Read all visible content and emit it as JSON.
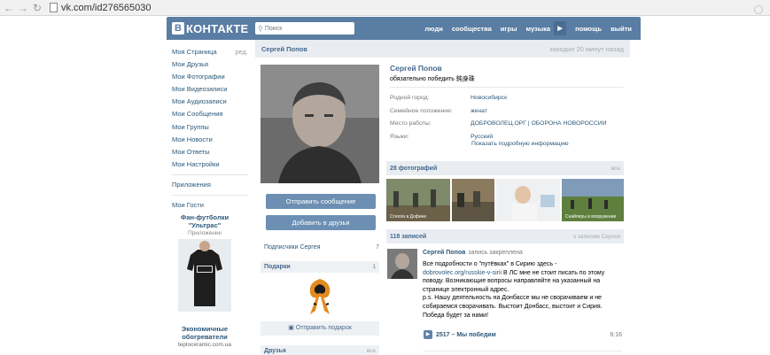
{
  "browser": {
    "url": "vk.com/id276565030"
  },
  "header": {
    "logo_letter": "В",
    "logo_text": "КОНТАКТЕ",
    "search_placeholder": "Поиск",
    "nav": [
      "люди",
      "сообщества",
      "игры",
      "музыка",
      "помощь",
      "выйти"
    ]
  },
  "menu": {
    "items": [
      {
        "label": "Моя Страница",
        "extra": "ред."
      },
      {
        "label": "Мои Друзья"
      },
      {
        "label": "Мои Фотографии"
      },
      {
        "label": "Мои Видеозаписи"
      },
      {
        "label": "Мои Аудиозаписи"
      },
      {
        "label": "Мои Сообщения"
      },
      {
        "label": "Мои Группы"
      },
      {
        "label": "Мои Новости"
      },
      {
        "label": "Мои Ответы"
      },
      {
        "label": "Мои Настройки"
      }
    ],
    "apps": "Приложения",
    "guests": "Мои Гости"
  },
  "ads": {
    "ad1_title": "Фан-футболки \"Ультрас\"",
    "ad1_sub": "Приложение",
    "ad2_title": "Экономичные обогреватели",
    "ad2_site": "teploceramic.com.ua"
  },
  "profile": {
    "title_name": "Сергей Попов",
    "last_seen": "заходил 20 минут назад",
    "name": "Сергей Попов",
    "status": "обязательно победить 鈍身硃",
    "info": [
      {
        "label": "Родной город:",
        "value": "Новосибирск"
      },
      {
        "label": "Семейное положение:",
        "value": "женат"
      },
      {
        "label": "Место работы:",
        "value": "ДОБРОВОЛЕЦ.ОРГ | ОБОРОНА НОВОРОССИИ"
      },
      {
        "label": "Языки:",
        "value": "Русский"
      }
    ],
    "show_more": "Показать подробную информацию",
    "btn_message": "Отправить сообщение",
    "btn_add": "Добавить в друзья",
    "subscribers_label": "Подписчики Сергея",
    "subscribers_count": "7",
    "gifts_label": "Подарки",
    "gifts_count": "1",
    "send_gift": "Отправить подарок",
    "friends_label": "Друзья",
    "friends_all": "все"
  },
  "photos": {
    "header": "28 фотографий",
    "all": "все",
    "captions": [
      "Стелла в Дофине",
      "",
      "",
      "Снайперы в вооружении"
    ]
  },
  "wall": {
    "header": "118 записей",
    "link_label": "к записям Сергея",
    "post": {
      "author": "Сергей Попов",
      "pinned": "запись закреплена",
      "line1": "Все подробности о \"путёвках\" в Сирию здесь -",
      "link": "dobrovolec.org/russkie-v-sirii",
      "line2": " В ЛС мне не стоит писать по этому поводу. Возникающие вопросы направляйте на указанный на странице электронный адрес.",
      "line3": "p.s. Нашу деятельность на Донбассе мы не сворачиваем и не собираемся сворачивать. Выстоит Донбасс, выстоит и Сирия. Победа будет за нами!",
      "audio_title": "2517 – Мы победим",
      "audio_duration": "6:16"
    }
  },
  "colors": {
    "brand": "#597da3",
    "link": "#2b587a",
    "button": "#6c8fb3"
  }
}
